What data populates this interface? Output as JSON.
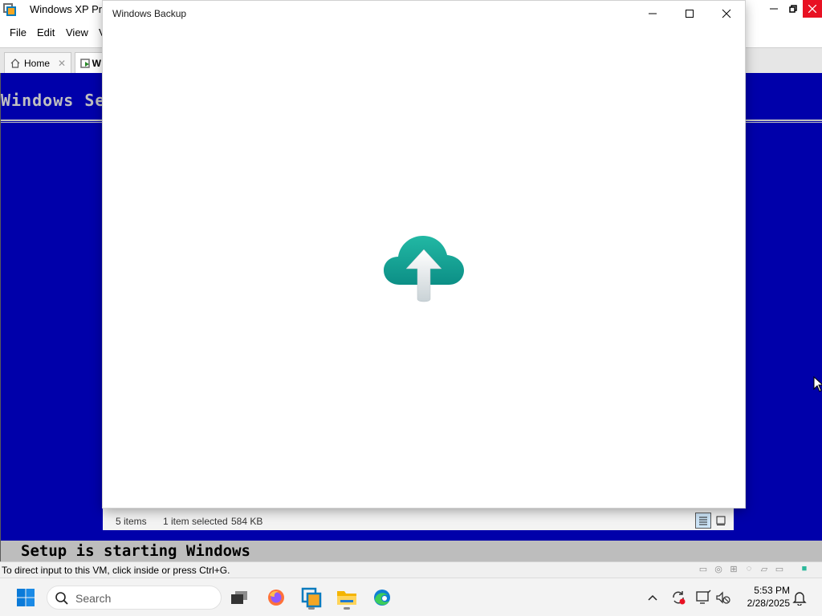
{
  "vmware": {
    "title": "Windows XP Prof",
    "menu": [
      "File",
      "Edit",
      "View",
      "V"
    ],
    "tabs": [
      {
        "label": "Home"
      },
      {
        "label": "W"
      }
    ],
    "status_hint": "To direct input to this VM, click inside or press Ctrl+G."
  },
  "guest": {
    "header_text": "Windows Se",
    "status_text": "Setup is starting Windows",
    "background_color": "#0000aa"
  },
  "backup_window": {
    "title": "Windows Backup",
    "logo_icon": "cloud-upload-icon",
    "accent_color": "#13a89e"
  },
  "explorer_status": {
    "items_count": "5 items",
    "selection": "1 item selected",
    "size": "584 KB"
  },
  "taskbar": {
    "search_placeholder": "Search",
    "apps": [
      "task-view-icon",
      "firefox-icon",
      "vmware-icon",
      "file-explorer-icon",
      "edge-icon"
    ],
    "clock_time": "5:53 PM",
    "clock_date": "2/28/2025"
  }
}
